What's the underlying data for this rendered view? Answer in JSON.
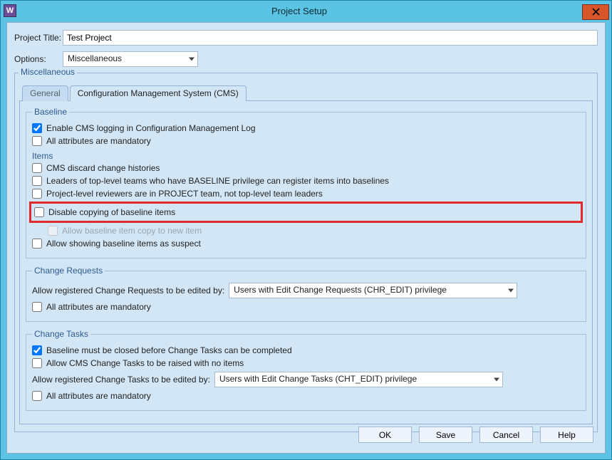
{
  "window": {
    "title": "Project Setup",
    "app_icon_letter": "W",
    "close_tooltip": "Close"
  },
  "fields": {
    "project_title_label": "Project Title:",
    "project_title_value": "Test Project",
    "options_label": "Options:",
    "options_value": "Miscellaneous"
  },
  "panel_title": "Miscellaneous",
  "tabs": {
    "general": "General",
    "cms": "Configuration Management System (CMS)"
  },
  "baseline": {
    "legend": "Baseline",
    "enable_cms_logging": "Enable CMS logging in Configuration Management Log",
    "all_attr_mandatory": "All attributes are mandatory",
    "items_header": "Items",
    "cms_discard": "CMS discard change histories",
    "leaders": "Leaders of top-level teams who have BASELINE privilege can register items into baselines",
    "reviewers": "Project-level reviewers are in PROJECT team, not top-level team leaders",
    "disable_copy": "Disable copying of baseline items",
    "allow_copy_new": "Allow baseline item copy to new item",
    "allow_suspect": "Allow showing baseline items as suspect"
  },
  "change_requests": {
    "legend": "Change Requests",
    "edited_by_label": "Allow registered Change Requests to be edited by:",
    "edited_by_value": "Users with Edit Change Requests (CHR_EDIT) privilege",
    "all_attr_mandatory": "All attributes are mandatory"
  },
  "change_tasks": {
    "legend": "Change Tasks",
    "baseline_closed": "Baseline must be closed before Change Tasks can be completed",
    "allow_no_items": "Allow CMS Change Tasks to be raised with no items",
    "edited_by_label": "Allow registered Change Tasks to be edited by:",
    "edited_by_value": "Users with Edit Change Tasks (CHT_EDIT) privilege",
    "all_attr_mandatory": "All attributes are mandatory"
  },
  "buttons": {
    "ok": "OK",
    "save": "Save",
    "cancel": "Cancel",
    "help": "Help"
  }
}
